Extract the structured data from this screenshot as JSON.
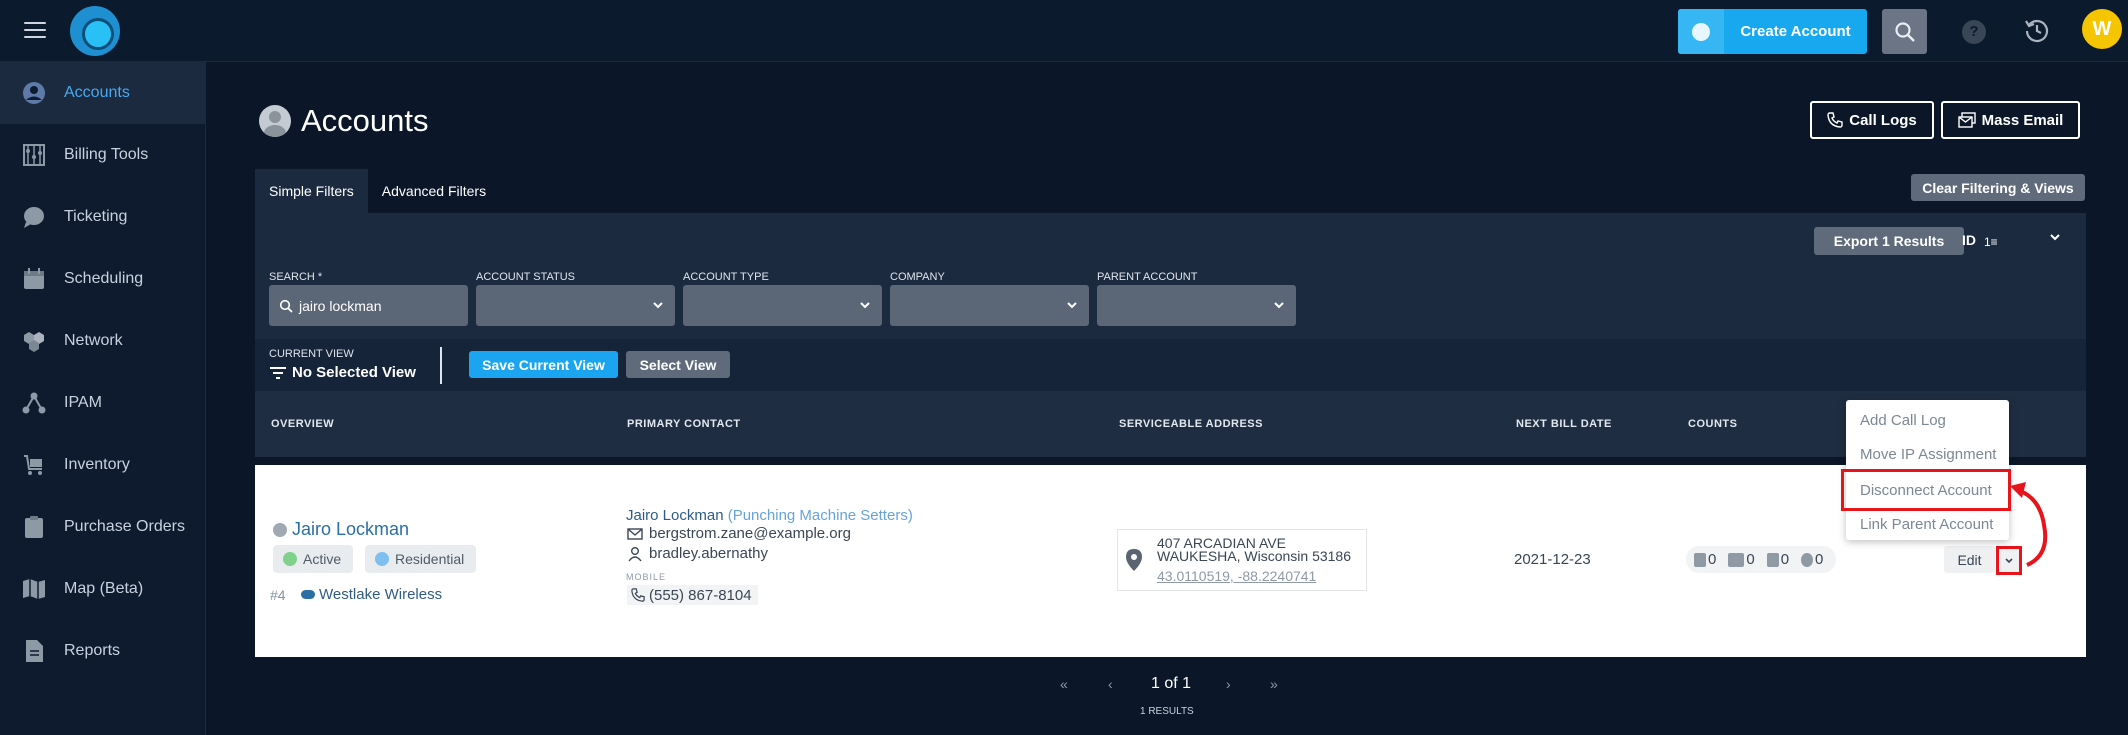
{
  "header": {
    "create_account_label": "Create Account",
    "help_glyph": "?",
    "user_initial": "W"
  },
  "sidebar": {
    "items": [
      {
        "label": "Accounts",
        "icon": "person-circle-icon",
        "active": true
      },
      {
        "label": "Billing Tools",
        "icon": "abacus-icon"
      },
      {
        "label": "Ticketing",
        "icon": "chat-bubble-icon"
      },
      {
        "label": "Scheduling",
        "icon": "calendar-icon"
      },
      {
        "label": "Network",
        "icon": "network-hex-icon"
      },
      {
        "label": "IPAM",
        "icon": "nodes-icon"
      },
      {
        "label": "Inventory",
        "icon": "cart-icon"
      },
      {
        "label": "Purchase Orders",
        "icon": "clipboard-icon"
      },
      {
        "label": "Map (Beta)",
        "icon": "map-icon"
      },
      {
        "label": "Reports",
        "icon": "document-icon"
      }
    ]
  },
  "page": {
    "title": "Accounts",
    "call_logs_label": "Call Logs",
    "mass_email_label": "Mass Email"
  },
  "filters": {
    "tabs": [
      "Simple Filters",
      "Advanced Filters"
    ],
    "clear_label": "Clear Filtering & Views",
    "export_label": "Export 1 Results",
    "sort_field": "ID",
    "sort_glyph": "1≡",
    "search_label": "SEARCH *",
    "search_value": "jairo lockman",
    "account_status_label": "ACCOUNT STATUS",
    "account_type_label": "ACCOUNT TYPE",
    "company_label": "COMPANY",
    "parent_account_label": "PARENT ACCOUNT",
    "current_view_label": "CURRENT VIEW",
    "current_view_value": "No Selected View",
    "save_view_label": "Save Current View",
    "select_view_label": "Select View"
  },
  "table": {
    "headers": [
      "OVERVIEW",
      "PRIMARY CONTACT",
      "SERVICEABLE ADDRESS",
      "NEXT BILL DATE",
      "COUNTS"
    ],
    "row": {
      "account_name": "Jairo Lockman",
      "status": "Active",
      "type": "Residential",
      "number": "#4",
      "company": "Westlake Wireless",
      "contact_name": "Jairo Lockman",
      "contact_title": "(Punching Machine Setters)",
      "email": "bergstrom.zane@example.org",
      "username": "bradley.abernathy",
      "mobile_label": "MOBILE",
      "phone": "(555) 867-8104",
      "address_line1": "407 ARCADIAN AVE",
      "address_line2": "WAUKESHA, Wisconsin 53186",
      "coordinates": "43.0110519, -88.2240741",
      "next_bill_date": "2021-12-23",
      "counts": [
        "0",
        "0",
        "0",
        "0"
      ],
      "edit_label": "Edit"
    }
  },
  "dropdown_menu": {
    "items": [
      "Add Call Log",
      "Move IP Assignment",
      "Disconnect Account",
      "Link Parent Account"
    ]
  },
  "pagination": {
    "first": "«",
    "prev": "‹",
    "current": "1 of 1",
    "next": "›",
    "last": "»",
    "results": "1 RESULTS"
  },
  "colors": {
    "accent": "#18a8f0",
    "highlight": "#e8141c",
    "active_status": "#7fd18b",
    "residential": "#7fbff0"
  }
}
